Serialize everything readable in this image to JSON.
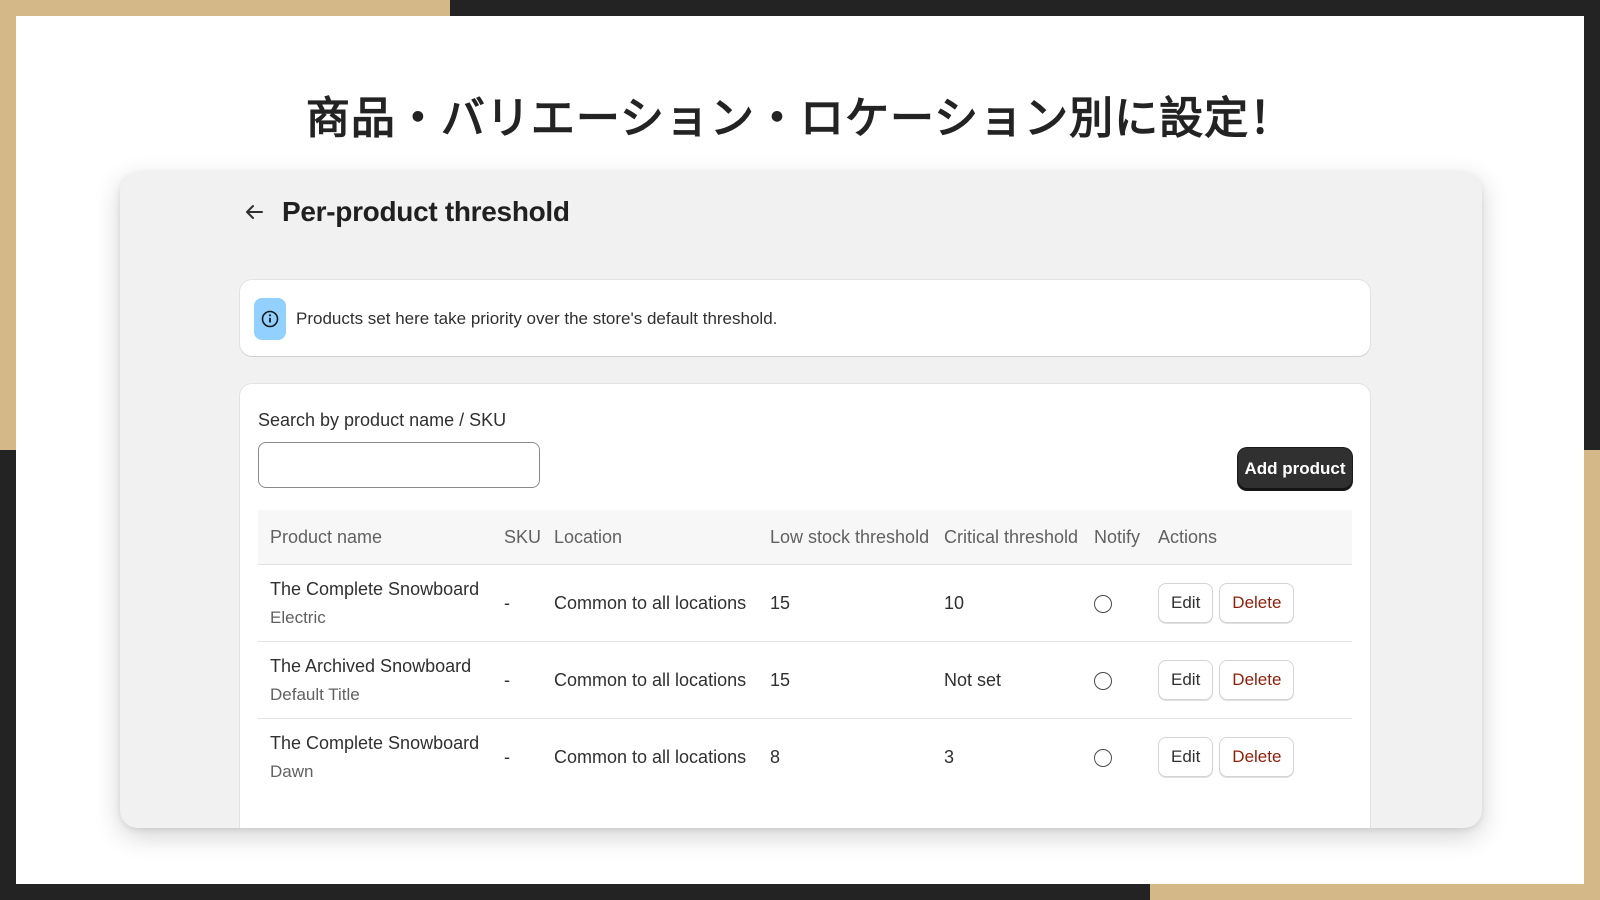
{
  "slide": {
    "title": "商品・バリエーション・ロケーション別に設定！"
  },
  "app": {
    "back_icon": "arrow-left-icon",
    "page_title": "Per-product threshold",
    "banner": {
      "icon": "info-icon",
      "text": "Products set here take priority over the store's default threshold."
    },
    "search": {
      "label": "Search by product name / SKU",
      "value": "",
      "placeholder": ""
    },
    "add_button_label": "Add product",
    "table": {
      "headers": {
        "product_name": "Product name",
        "sku": "SKU",
        "location": "Location",
        "low_stock": "Low stock threshold",
        "critical": "Critical threshold",
        "notify": "Notify",
        "actions": "Actions"
      },
      "rows": [
        {
          "name": "The Complete Snowboard",
          "variant": "Electric",
          "sku": "-",
          "location": "Common to all locations",
          "low_stock": "15",
          "critical": "10",
          "notify": false,
          "edit_label": "Edit",
          "delete_label": "Delete"
        },
        {
          "name": "The Archived Snowboard",
          "variant": "Default Title",
          "sku": "-",
          "location": "Common to all locations",
          "low_stock": "15",
          "critical": "Not set",
          "notify": false,
          "edit_label": "Edit",
          "delete_label": "Delete"
        },
        {
          "name": "The Complete Snowboard",
          "variant": "Dawn",
          "sku": "-",
          "location": "Common to all locations",
          "low_stock": "8",
          "critical": "3",
          "notify": false,
          "edit_label": "Edit",
          "delete_label": "Delete"
        }
      ]
    }
  },
  "colors": {
    "accent_gold": "#d5b887",
    "dark": "#232323",
    "info_bg": "#91d0ff",
    "delete_red": "#8e1f0b"
  }
}
